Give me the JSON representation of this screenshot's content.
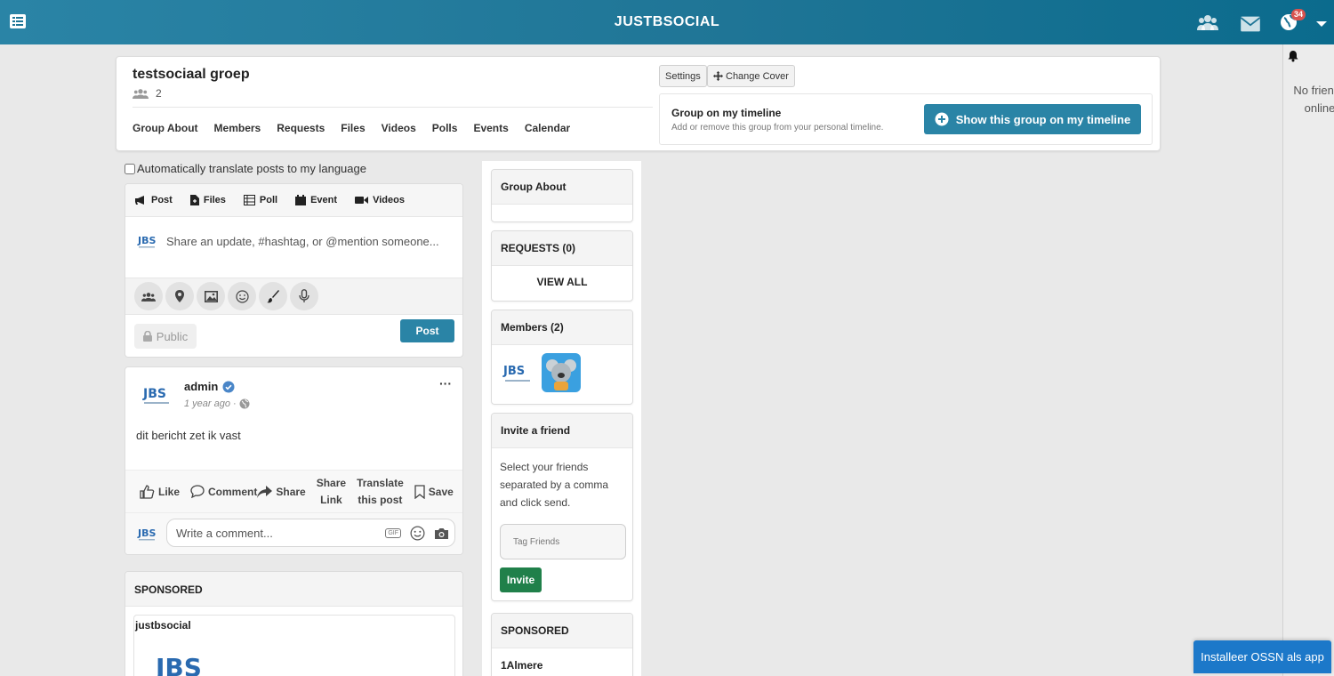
{
  "topbar": {
    "brand": "JUSTBSOCIAL",
    "notification_count": "34"
  },
  "right_sidebar": {
    "no_friends_text": "No friends online"
  },
  "group": {
    "title": "testsociaal groep",
    "member_count": "2",
    "settings_label": "Settings",
    "change_cover_label": "Change Cover",
    "tabs": [
      "Group About",
      "Members",
      "Requests",
      "Files",
      "Videos",
      "Polls",
      "Events",
      "Calendar"
    ],
    "timeline_title": "Group on my timeline",
    "timeline_subtitle": "Add or remove this group from your personal timeline.",
    "show_on_timeline_label": "Show this group on my timeline"
  },
  "translate": {
    "label": "Automatically translate posts to my language"
  },
  "composer": {
    "tabs": [
      "Post",
      "Files",
      "Poll",
      "Event",
      "Videos"
    ],
    "placeholder": "Share an update, #hashtag, or @mention someone...",
    "privacy_label": "Public",
    "post_label": "Post"
  },
  "post": {
    "author": "admin",
    "time": "1 year ago",
    "text": "dit bericht zet ik vast",
    "actions": {
      "like": "Like",
      "comment": "Comment",
      "share": "Share",
      "share_link_1": "Share",
      "share_link_2": "Link",
      "translate_1": "Translate",
      "translate_2": "this post",
      "save": "Save"
    },
    "comment_placeholder": "Write a comment...",
    "gif_label": "GIF"
  },
  "sponsored_left": {
    "heading": "SPONSORED",
    "name": "justbsocial"
  },
  "mid": {
    "group_about": "Group About",
    "requests": "REQUESTS (0)",
    "view_all": "VIEW ALL",
    "members": "Members (2)",
    "invite_heading": "Invite a friend",
    "invite_text": "Select your friends separated by a comma and click send.",
    "tag_placeholder": "Tag Friends",
    "invite_button": "Invite",
    "sponsored_heading": "SPONSORED",
    "sponsored_item": "1Almere"
  },
  "install_button": "Installeer OSSN als app",
  "colors": {
    "brand": "#2a84a6",
    "invite_green": "#20804a",
    "install_blue": "#1c78c9",
    "badge_red": "#d9534f"
  }
}
